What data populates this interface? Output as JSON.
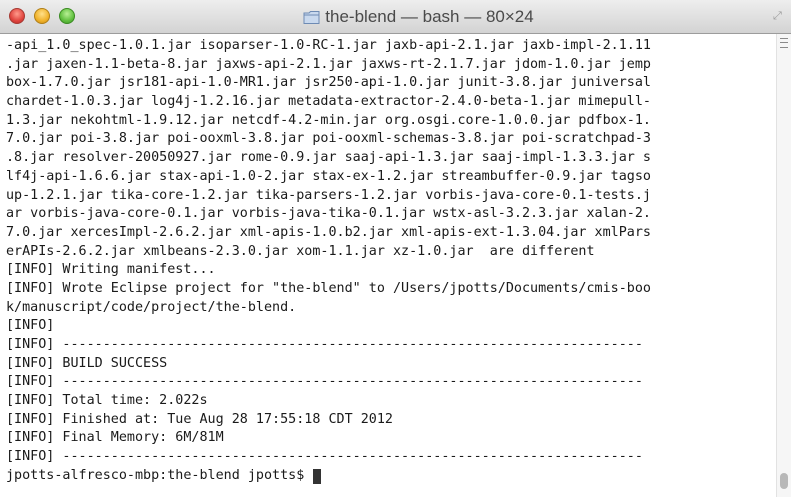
{
  "window": {
    "title": "the-blend — bash — 80×24"
  },
  "terminal": {
    "lines": [
      "-api_1.0_spec-1.0.1.jar isoparser-1.0-RC-1.jar jaxb-api-2.1.jar jaxb-impl-2.1.11",
      ".jar jaxen-1.1-beta-8.jar jaxws-api-2.1.jar jaxws-rt-2.1.7.jar jdom-1.0.jar jemp",
      "box-1.7.0.jar jsr181-api-1.0-MR1.jar jsr250-api-1.0.jar junit-3.8.jar juniversal",
      "chardet-1.0.3.jar log4j-1.2.16.jar metadata-extractor-2.4.0-beta-1.jar mimepull-",
      "1.3.jar nekohtml-1.9.12.jar netcdf-4.2-min.jar org.osgi.core-1.0.0.jar pdfbox-1.",
      "7.0.jar poi-3.8.jar poi-ooxml-3.8.jar poi-ooxml-schemas-3.8.jar poi-scratchpad-3",
      ".8.jar resolver-20050927.jar rome-0.9.jar saaj-api-1.3.jar saaj-impl-1.3.3.jar s",
      "lf4j-api-1.6.6.jar stax-api-1.0-2.jar stax-ex-1.2.jar streambuffer-0.9.jar tagso",
      "up-1.2.1.jar tika-core-1.2.jar tika-parsers-1.2.jar vorbis-java-core-0.1-tests.j",
      "ar vorbis-java-core-0.1.jar vorbis-java-tika-0.1.jar wstx-asl-3.2.3.jar xalan-2.",
      "7.0.jar xercesImpl-2.6.2.jar xml-apis-1.0.b2.jar xml-apis-ext-1.3.04.jar xmlPars",
      "erAPIs-2.6.2.jar xmlbeans-2.3.0.jar xom-1.1.jar xz-1.0.jar  are different",
      "[INFO] Writing manifest...",
      "[INFO] Wrote Eclipse project for \"the-blend\" to /Users/jpotts/Documents/cmis-boo",
      "k/manuscript/code/project/the-blend.",
      "[INFO]",
      "[INFO] ------------------------------------------------------------------------",
      "[INFO] BUILD SUCCESS",
      "[INFO] ------------------------------------------------------------------------",
      "[INFO] Total time: 2.022s",
      "[INFO] Finished at: Tue Aug 28 17:55:18 CDT 2012",
      "[INFO] Final Memory: 6M/81M",
      "[INFO] ------------------------------------------------------------------------"
    ],
    "prompt": "jpotts-alfresco-mbp:the-blend jpotts$ "
  },
  "icons": {
    "folder": "folder-icon",
    "resize": "fullscreen-icon",
    "cursor": "block-cursor"
  },
  "colors": {
    "close": "#e0443e",
    "minimize": "#f0b22b",
    "maximize": "#61c03f",
    "text": "#1a1a1a"
  }
}
